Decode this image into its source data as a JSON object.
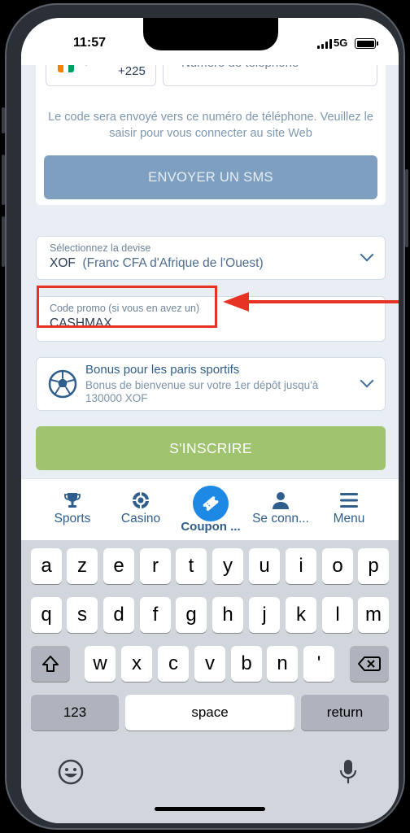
{
  "status_bar": {
    "time": "11:57",
    "network": "5G",
    "battery_icon": "battery-icon",
    "signal_icon": "signal-icon"
  },
  "phone_field": {
    "country_code": "+225",
    "placeholder": "Numéro de téléphone",
    "flag_colors": [
      "#f77f00",
      "#ffffff",
      "#009e60"
    ]
  },
  "sms_hint": "Le code sera envoyé vers ce numéro de téléphone. Veuillez le saisir pour vous connecter au site Web",
  "sms_button": "ENVOYER UN SMS",
  "currency": {
    "label": "Sélectionnez la devise",
    "code": "XOF",
    "name": "(Franc CFA d'Afrique de l'Ouest)"
  },
  "promo": {
    "label": "Code promo (si vous en avez un)",
    "value": "CASHMAX"
  },
  "bonus": {
    "title": "Bonus pour les paris sportifs",
    "description": "Bonus de bienvenue sur votre 1er dépôt jusqu'à 130000 XOF"
  },
  "signup_button": "S'INSCRIRE",
  "tabs": [
    {
      "label": "Sports",
      "icon": "trophy-icon"
    },
    {
      "label": "Casino",
      "icon": "casino-chip-icon"
    },
    {
      "label": "Coupon ...",
      "icon": "ticket-icon",
      "active": true
    },
    {
      "label": "Se conn...",
      "icon": "user-icon"
    },
    {
      "label": "Menu",
      "icon": "menu-icon"
    }
  ],
  "keyboard": {
    "row1": [
      "a",
      "z",
      "e",
      "r",
      "t",
      "y",
      "u",
      "i",
      "o",
      "p"
    ],
    "row2": [
      "q",
      "s",
      "d",
      "f",
      "g",
      "h",
      "j",
      "k",
      "l",
      "m"
    ],
    "row3": [
      "w",
      "x",
      "c",
      "v",
      "b",
      "n",
      "'"
    ],
    "numbers_key": "123",
    "space_key": "space",
    "return_key": "return"
  },
  "colors": {
    "accent_blue": "#2f5d8c",
    "sms_button": "#7e9fbf",
    "signup_button": "#9fc36f",
    "highlight_red": "#e63323",
    "active_tab": "#1e88e5"
  }
}
